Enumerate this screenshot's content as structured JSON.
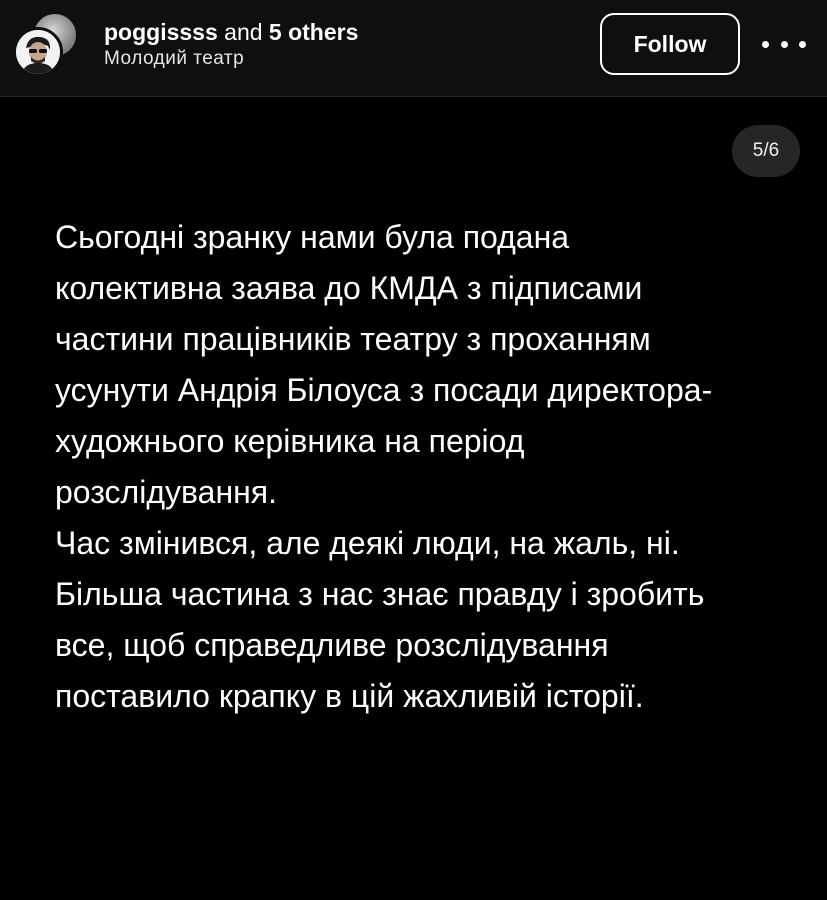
{
  "header": {
    "username": "poggissss",
    "and_text": " and ",
    "others_text": "5 others",
    "subtitle": "Молодий театр",
    "follow_label": "Follow"
  },
  "post": {
    "counter": "5/6",
    "lines": [
      "Сьогодні зранку нами була подана",
      "колективна заява до КМДА з підписами",
      "частини працівників театру з проханням",
      "усунути Андрія Білоуса з посади директора-",
      "художнього керівника на період",
      "розслідування.",
      "Час змінився, але деякі люди, на жаль, ні.",
      "Більша частина з нас знає правду і зробить",
      "все, щоб справедливе розслідування",
      "поставило крапку в цій жахливій історії."
    ]
  },
  "icons": {
    "more": "more-options-icon",
    "avatar": "avatar-icon"
  },
  "colors": {
    "background": "#000000",
    "header_background": "#0f0f0f",
    "counter_background": "#262626",
    "text": "#ffffff"
  }
}
